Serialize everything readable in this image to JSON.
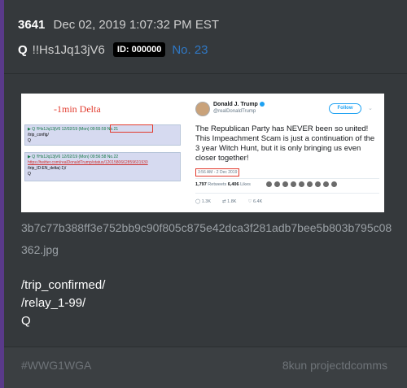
{
  "post": {
    "number": "3641",
    "datetime": "Dec 02, 2019 1:07:32 PM EST",
    "author": "Q",
    "tripcode": "!!Hs1Jq13jV6",
    "id_badge": "ID: 000000",
    "post_ref": "No. 23"
  },
  "attachment": {
    "delta_label": "-1min Delta",
    "posts": [
      {
        "header": "▶ Q !!Hs1Jq13jV6  12/02/19 (Mon) 09:55:59 No.21",
        "lines": [
          "/trip_config/",
          "Q"
        ]
      },
      {
        "header": "▶ Q !!Hs1Jq13jV6  12/02/19 (Mon) 09:56:58 No.22",
        "link": "https://twitter.com/realDonaldTrump/status/1201580662859601930",
        "lines": [
          "/trip_ID:EN_delta(-1)/",
          "Q"
        ]
      }
    ],
    "tweet": {
      "name": "Donald J. Trump",
      "handle": "@realDonaldTrump",
      "follow": "Follow",
      "text": "The Republican Party has NEVER been so united! This Impeachment Scam is just a continuation of the 3 year Witch Hunt, but it is only bringing us even closer together!",
      "timestamp": "3:56 AM - 2 Dec 2019",
      "retweets": "1,797",
      "retweets_label": "Retweets",
      "likes": "6,406",
      "likes_label": "Likes",
      "reply_count": "1.3K",
      "retweet_count": "1.8K",
      "like_count": "6.4K"
    }
  },
  "filename": "3b7c77b388ff3e752bb9c90f805c875e42dca3f281adb7bee5b803b795c08362.jpg",
  "message": [
    "/trip_confirmed/",
    "/relay_1-99/",
    "Q"
  ],
  "footer": {
    "hashtag": "#WWG1WGA",
    "source": "8kun projectdcomms"
  },
  "colors": {
    "background": "#35393c",
    "accent": "#5a3a8a",
    "link_blue": "#2f78c5",
    "delta_red": "#e23b2e"
  }
}
